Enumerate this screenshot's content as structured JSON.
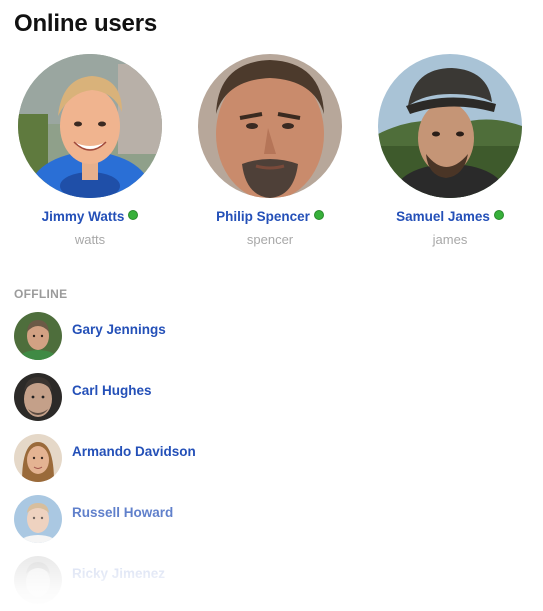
{
  "header": {
    "title": "Online users"
  },
  "online_users": [
    {
      "name": "Jimmy Watts",
      "handle": "watts",
      "status": "online"
    },
    {
      "name": "Philip Spencer",
      "handle": "spencer",
      "status": "online"
    },
    {
      "name": "Samuel James",
      "handle": "james",
      "status": "online"
    }
  ],
  "offline_section": {
    "label": "OFFLINE",
    "users": [
      {
        "name": "Gary Jennings"
      },
      {
        "name": "Carl Hughes"
      },
      {
        "name": "Armando Davidson"
      },
      {
        "name": "Russell Howard"
      },
      {
        "name": "Ricky Jimenez"
      }
    ]
  },
  "colors": {
    "link": "#2450b8",
    "online_indicator": "#37b03a",
    "muted": "#a8a8a8"
  }
}
